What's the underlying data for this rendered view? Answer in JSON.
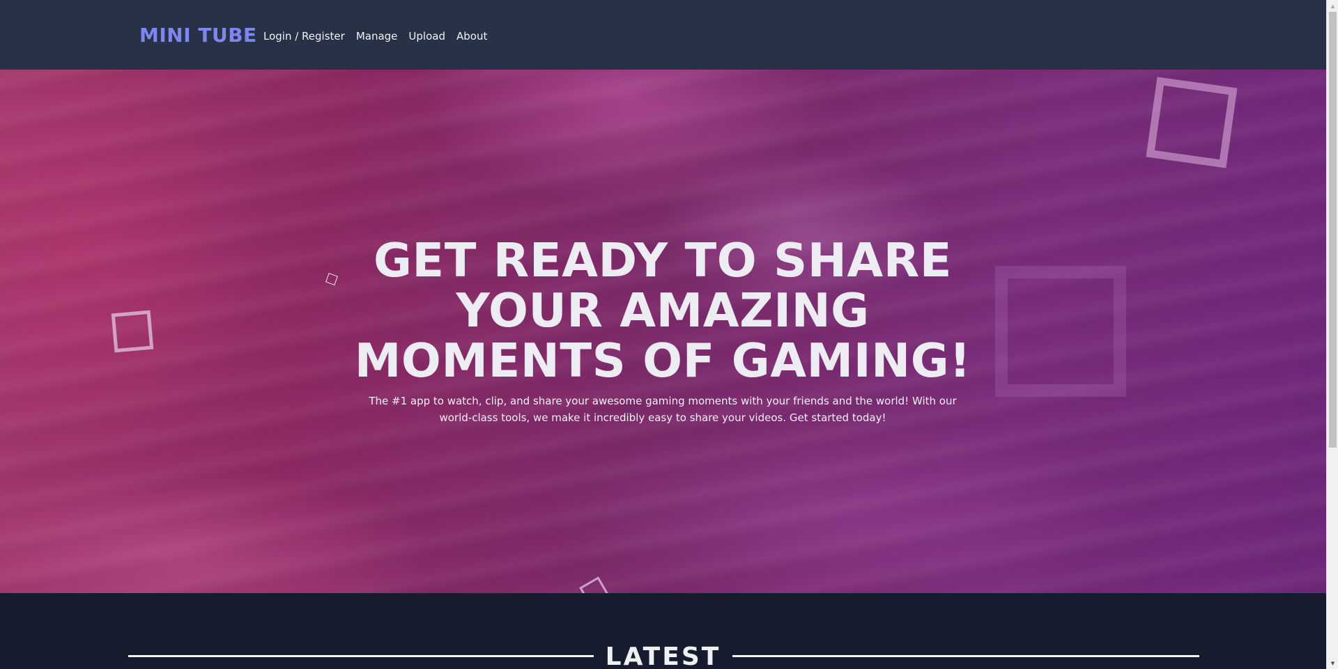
{
  "header": {
    "brand": "MINI TUBE",
    "nav": [
      {
        "label": "Login / Register"
      },
      {
        "label": "Manage"
      },
      {
        "label": "Upload"
      },
      {
        "label": "About"
      }
    ]
  },
  "hero": {
    "title_line1": "GET READY TO SHARE",
    "title_line2": "YOUR AMAZING",
    "title_line3": "MOMENTS OF GAMING!",
    "subtitle": "The #1 app to watch, clip, and share your awesome gaming moments with your friends and the world! With our world-class tools, we make it incredibly easy to share your videos. Get started today!"
  },
  "latest": {
    "title": "LATEST"
  },
  "colors": {
    "header_bg": "#283247",
    "brand": "#7f86f0",
    "page_bg": "#161c2e",
    "hero_pink": "#a63a6e",
    "hero_purple": "#6d2779"
  },
  "scrollbar": {
    "up_icon": "scroll-up-arrow",
    "down_icon": "scroll-down-arrow"
  }
}
